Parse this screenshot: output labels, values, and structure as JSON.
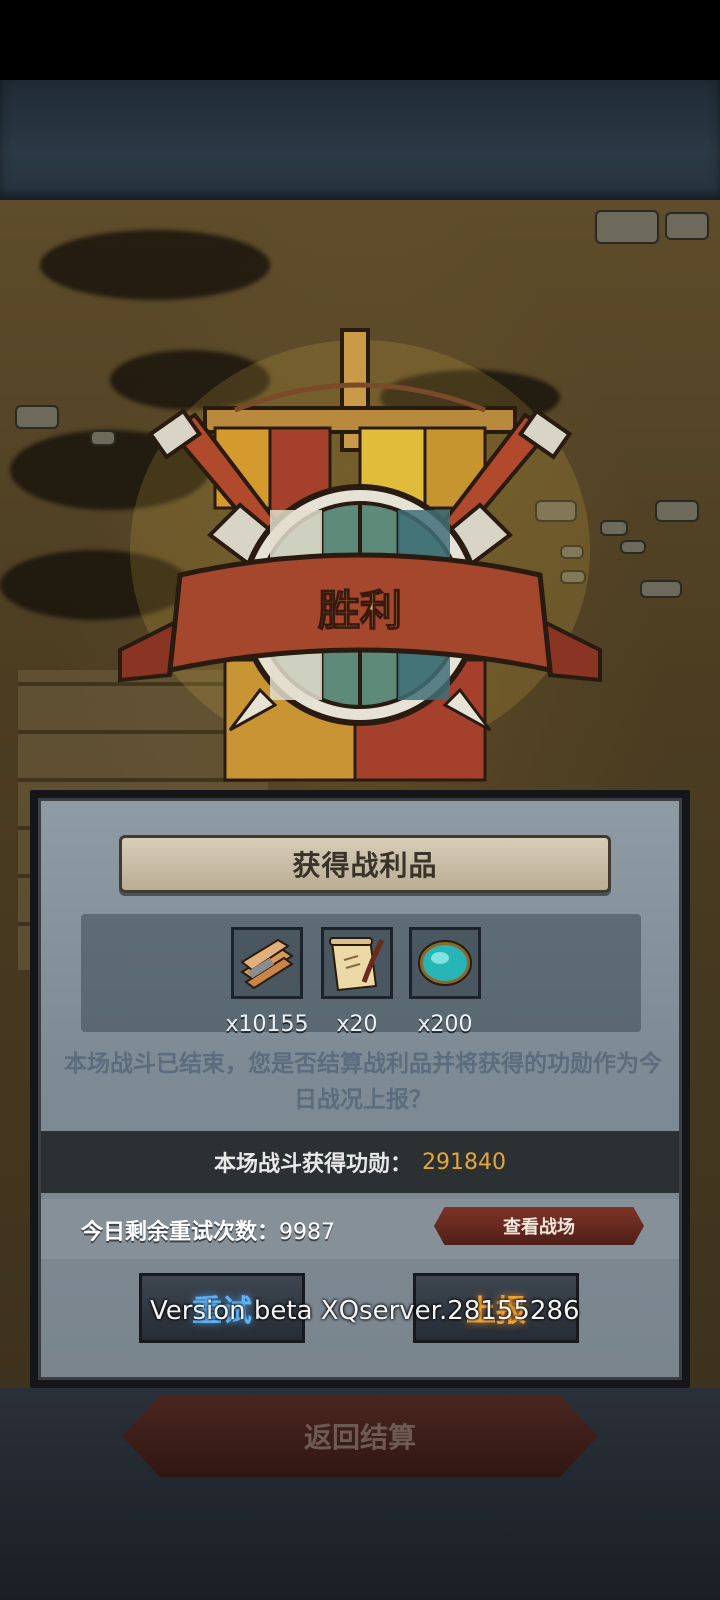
{
  "result_title": "胜利",
  "panel": {
    "title": "获得战利品",
    "loot": [
      {
        "icon": "wood-planks-icon",
        "count": "x10155"
      },
      {
        "icon": "scroll-quill-icon",
        "count": "x20"
      },
      {
        "icon": "turquoise-gem-icon",
        "count": "x200"
      }
    ],
    "message": "本场战斗已结束，您是否结算战利品并将获得的功勋作为今日战况上报？",
    "merit_label": "本场战斗获得功勋：",
    "merit_value": "291840",
    "retry_label": "今日剩余重试次数：",
    "retry_count": "9987",
    "view_battlefield": "查看战场",
    "retry_button": "重试",
    "report_button": "上报"
  },
  "version": "Version beta XQserver.28155286",
  "return_button": "返回结算",
  "colors": {
    "merit_value": "#e4a53a",
    "retry_button_text": "#5fb3f5",
    "report_button_text": "#f3a336",
    "banner_red": "#a5402c"
  }
}
